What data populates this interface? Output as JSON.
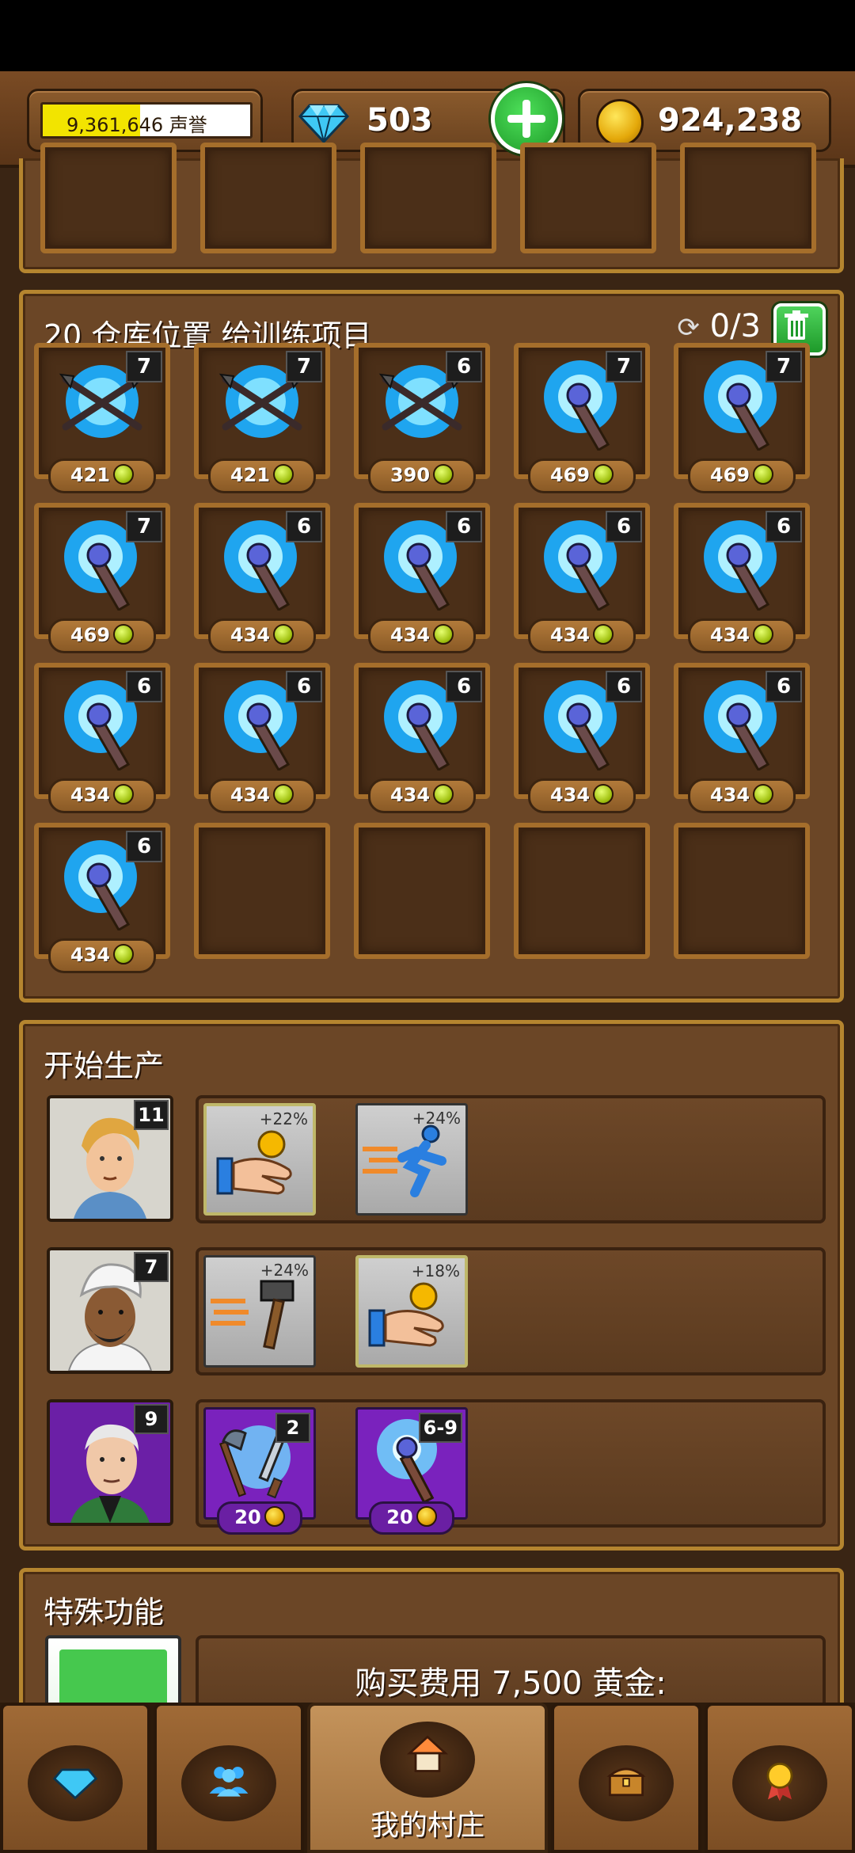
{
  "resources": {
    "fame_value": "9,361,646",
    "fame_unit": "声誉",
    "fame_fill": 0.47,
    "gems": "503",
    "gold": "924,238"
  },
  "storage": {
    "title": "20 仓库位置 给训练项目",
    "counter": "0/3",
    "items": [
      {
        "icon": "crossed-spears",
        "level": "7",
        "price": "421"
      },
      {
        "icon": "crossed-spears",
        "level": "7",
        "price": "421"
      },
      {
        "icon": "crossed-spears",
        "level": "6",
        "price": "390"
      },
      {
        "icon": "magic-staff",
        "level": "7",
        "price": "469"
      },
      {
        "icon": "magic-staff",
        "level": "7",
        "price": "469"
      },
      {
        "icon": "magic-staff",
        "level": "7",
        "price": "469"
      },
      {
        "icon": "magic-staff",
        "level": "6",
        "price": "434"
      },
      {
        "icon": "magic-staff",
        "level": "6",
        "price": "434"
      },
      {
        "icon": "magic-staff",
        "level": "6",
        "price": "434"
      },
      {
        "icon": "magic-staff",
        "level": "6",
        "price": "434"
      },
      {
        "icon": "magic-staff",
        "level": "6",
        "price": "434"
      },
      {
        "icon": "magic-staff",
        "level": "6",
        "price": "434"
      },
      {
        "icon": "magic-staff",
        "level": "6",
        "price": "434"
      },
      {
        "icon": "magic-staff",
        "level": "6",
        "price": "434"
      },
      {
        "icon": "magic-staff",
        "level": "6",
        "price": "434"
      },
      {
        "icon": "magic-staff",
        "level": "6",
        "price": "434"
      }
    ],
    "total_slots": 20
  },
  "production": {
    "title": "开始生产",
    "workers": [
      {
        "level": "11",
        "skills": [
          {
            "type": "coin-hand",
            "pct": "+22%",
            "selected": true
          },
          {
            "type": "speed-runner",
            "pct": "+24%",
            "selected": false
          }
        ]
      },
      {
        "level": "7",
        "skills": [
          {
            "type": "hammer",
            "pct": "+24%",
            "selected": false
          },
          {
            "type": "coin-hand",
            "pct": "+18%",
            "selected": true
          }
        ]
      },
      {
        "level": "9",
        "skills": [
          {
            "type": "axe-sword",
            "level": "2",
            "cost": "20"
          },
          {
            "type": "magic-staff",
            "level": "6-9",
            "cost": "20"
          }
        ]
      }
    ]
  },
  "special": {
    "title": "特殊功能",
    "buy_text": "购买费用 7,500 黄金:"
  },
  "nav": {
    "village_label": "我的村庄"
  }
}
